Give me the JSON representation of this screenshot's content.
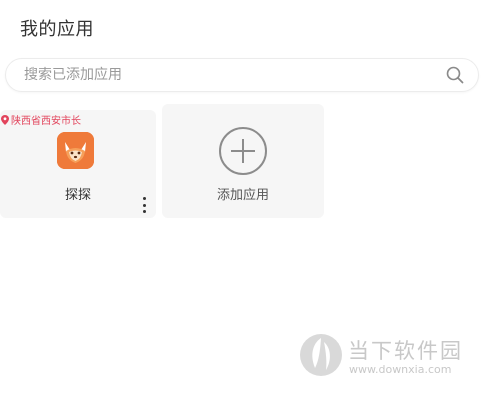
{
  "header": {
    "title": "我的应用"
  },
  "search": {
    "placeholder": "搜索已添加应用",
    "value": "",
    "icon": "search-icon"
  },
  "apps": [
    {
      "name": "探探",
      "location": "陕西省西安市长",
      "icon": "tantan-fox-icon",
      "icon_color": "#ef7a3a",
      "menu_icon": "more-vertical-icon"
    }
  ],
  "add_app": {
    "label": "添加应用",
    "icon": "plus-circle-icon"
  },
  "watermark": {
    "title": "当下软件园",
    "url": "www.downxia.com"
  },
  "colors": {
    "location": "#e2445c",
    "card_background": "#f6f6f6",
    "watermark": "#c8c8c8"
  }
}
